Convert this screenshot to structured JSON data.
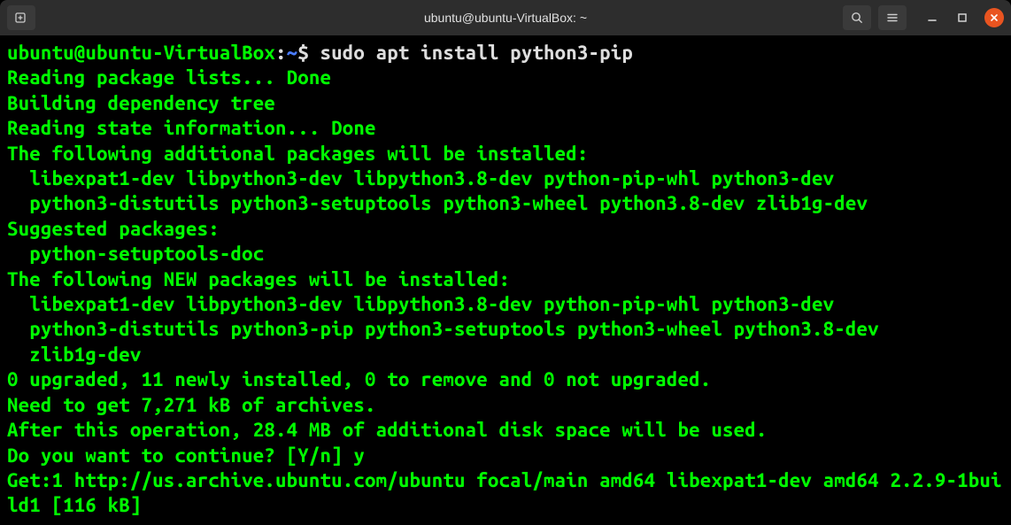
{
  "titlebar": {
    "title": "ubuntu@ubuntu-VirtualBox: ~"
  },
  "prompt": {
    "user_host": "ubuntu@ubuntu-VirtualBox",
    "colon": ":",
    "path": "~",
    "dollar": "$ ",
    "command": "sudo apt install python3-pip"
  },
  "output": {
    "l1": "Reading package lists... Done",
    "l2": "Building dependency tree",
    "l3": "Reading state information... Done",
    "l4": "The following additional packages will be installed:",
    "l5": "  libexpat1-dev libpython3-dev libpython3.8-dev python-pip-whl python3-dev",
    "l6": "  python3-distutils python3-setuptools python3-wheel python3.8-dev zlib1g-dev",
    "l7": "Suggested packages:",
    "l8": "  python-setuptools-doc",
    "l9": "The following NEW packages will be installed:",
    "l10": "  libexpat1-dev libpython3-dev libpython3.8-dev python-pip-whl python3-dev",
    "l11": "  python3-distutils python3-pip python3-setuptools python3-wheel python3.8-dev",
    "l12": "  zlib1g-dev",
    "l13": "0 upgraded, 11 newly installed, 0 to remove and 0 not upgraded.",
    "l14": "Need to get 7,271 kB of archives.",
    "l15": "After this operation, 28.4 MB of additional disk space will be used.",
    "l16": "Do you want to continue? [Y/n] y",
    "l17": "Get:1 http://us.archive.ubuntu.com/ubuntu focal/main amd64 libexpat1-dev amd64 2.2.9-1build1 [116 kB]"
  }
}
